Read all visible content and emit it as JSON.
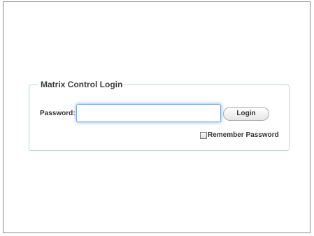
{
  "login": {
    "title": "Matrix Control Login",
    "password_label": "Password:",
    "password_value": "",
    "login_button": "Login",
    "remember_label": "Remember Password",
    "remember_checked": false
  },
  "colors": {
    "fieldset_border": "#bcd6d6",
    "input_focus_glow": "#7fa7dd",
    "frame_border": "#8a8a8a"
  }
}
